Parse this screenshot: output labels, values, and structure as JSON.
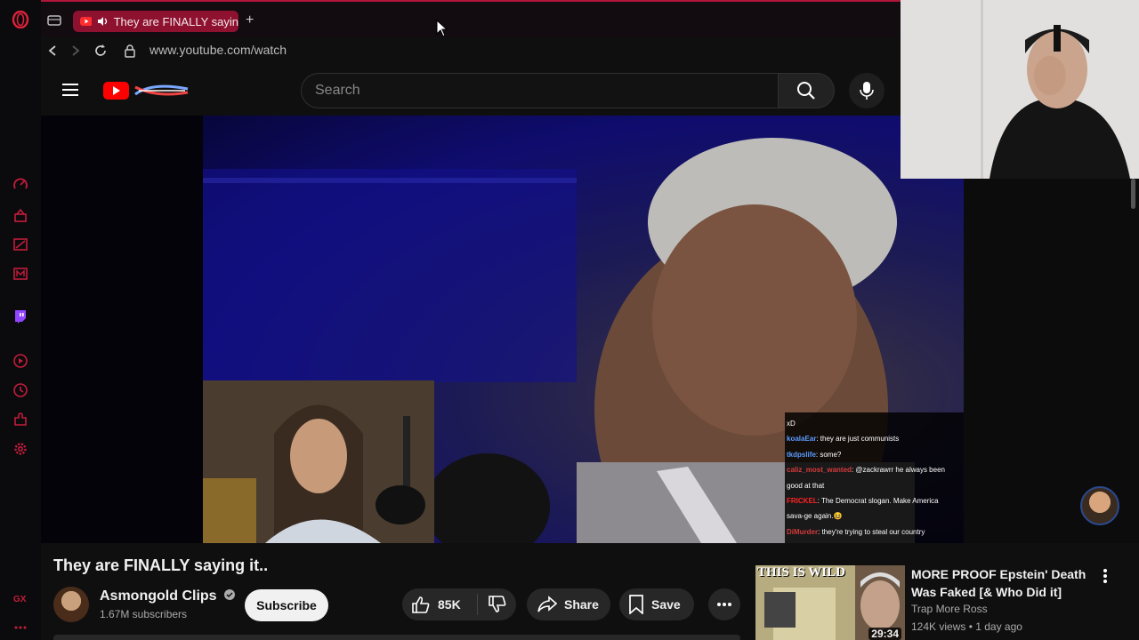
{
  "browser": {
    "tab_title": "They are FINALLY sayin",
    "url": "www.youtube.com/watch",
    "new_tab_label": "+"
  },
  "youtube": {
    "search_placeholder": "Search"
  },
  "chat": [
    {
      "user": "",
      "user_color": "#ffffff",
      "text": "xD"
    },
    {
      "user": "koalaEar",
      "user_color": "#5b9bff",
      "text": ": they are just communists"
    },
    {
      "user": "tkdpslife",
      "user_color": "#5b9bff",
      "text": ": some?"
    },
    {
      "user": "caliz_most_wanted",
      "user_color": "#d63a3a",
      "text": ": @zackrawrr he always been"
    },
    {
      "user": "",
      "user_color": "#ffffff",
      "text": "good at that"
    },
    {
      "user": "FRICKEL",
      "user_color": "#ff2222",
      "text": ": The Democrat slogan. Make America"
    },
    {
      "user": "",
      "user_color": "#ffffff",
      "text": "sava-ge again.😆"
    },
    {
      "user": "DiMurder",
      "user_color": "#d63a3a",
      "text": ": they're trying to steal our country"
    }
  ],
  "video": {
    "title": "They are FINALLY saying it..",
    "channel": "Asmongold Clips",
    "subscribers": "1.67M subscribers",
    "subscribe_label": "Subscribe",
    "likes": "85K",
    "share_label": "Share",
    "save_label": "Save"
  },
  "recommendation": {
    "title": "MORE PROOF Epstein' Death Was Faked [& Who Did it]",
    "channel": "Trap More Ross",
    "meta": "124K views • 1 day ago",
    "duration": "29:34",
    "thumb_text": "THIS IS WILD"
  },
  "colors": {
    "accent": "#b0153a",
    "youtube_red": "#ff0000"
  }
}
